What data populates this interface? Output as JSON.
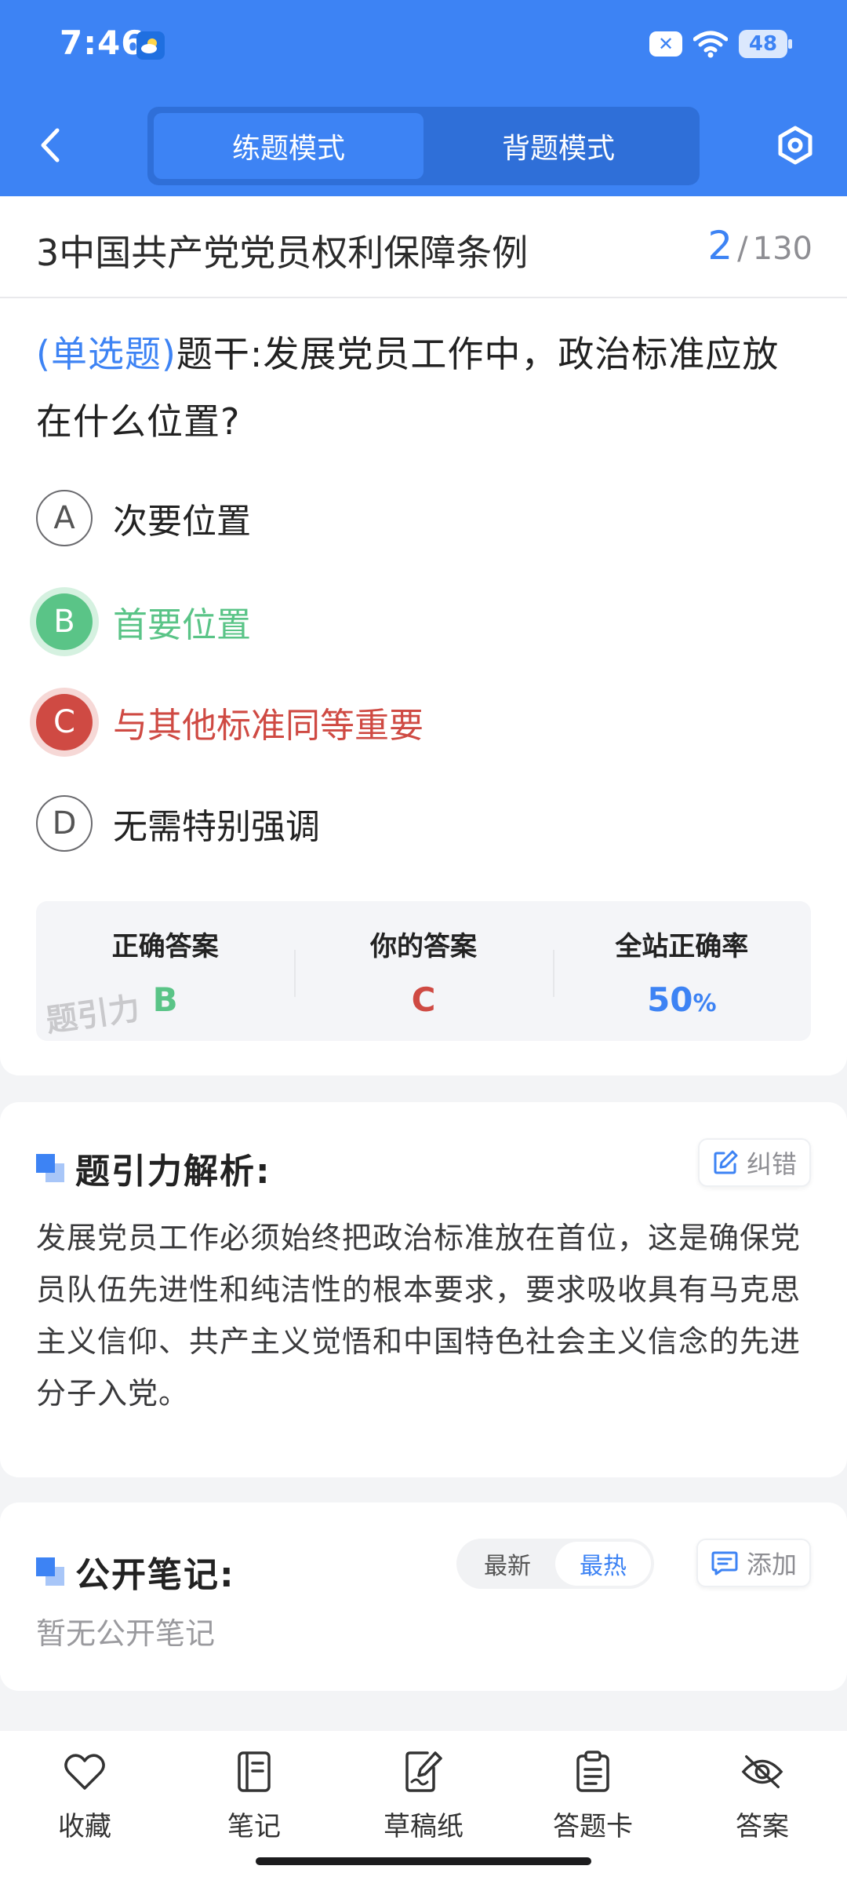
{
  "status_bar": {
    "time": "7:46",
    "battery": "48"
  },
  "header": {
    "tabs": [
      {
        "label": "练题模式",
        "active": true
      },
      {
        "label": "背题模式",
        "active": false
      }
    ]
  },
  "title_row": {
    "title": "3中国共产党党员权利保障条例",
    "current": "2",
    "separator": "/",
    "total": "130"
  },
  "question": {
    "type_label": "(单选题)",
    "text": "题干:发展党员工作中，政治标准应放在什么位置?",
    "options": [
      {
        "letter": "A",
        "text": "次要位置",
        "state": "normal"
      },
      {
        "letter": "B",
        "text": "首要位置",
        "state": "correct"
      },
      {
        "letter": "C",
        "text": "与其他标准同等重要",
        "state": "wrong"
      },
      {
        "letter": "D",
        "text": "无需特别强调",
        "state": "normal"
      }
    ]
  },
  "stats": {
    "correct_label": "正确答案",
    "correct_value": "B",
    "yours_label": "你的答案",
    "yours_value": "C",
    "rate_label": "全站正确率",
    "rate_value": "50",
    "rate_unit": "%",
    "watermark": "题引力"
  },
  "analysis": {
    "title": "题引力解析:",
    "report_label": "纠错",
    "text": "发展党员工作必须始终把政治标准放在首位，这是确保党员队伍先进性和纯洁性的根本要求，要求吸收具有马克思主义信仰、共产主义觉悟和中国特色社会主义信念的先进分子入党。"
  },
  "notes": {
    "title": "公开笔记:",
    "sort_tabs": [
      {
        "label": "最新",
        "active": false
      },
      {
        "label": "最热",
        "active": true
      }
    ],
    "add_label": "添加",
    "empty_text": "暂无公开笔记"
  },
  "bottom_nav": [
    {
      "label": "收藏",
      "icon": "heart-icon"
    },
    {
      "label": "笔记",
      "icon": "notebook-icon"
    },
    {
      "label": "草稿纸",
      "icon": "draft-icon"
    },
    {
      "label": "答题卡",
      "icon": "answer-sheet-icon"
    },
    {
      "label": "答案",
      "icon": "eye-off-icon"
    }
  ],
  "colors": {
    "primary": "#3d83f4",
    "correct": "#5ac487",
    "wrong": "#cf4a43"
  }
}
